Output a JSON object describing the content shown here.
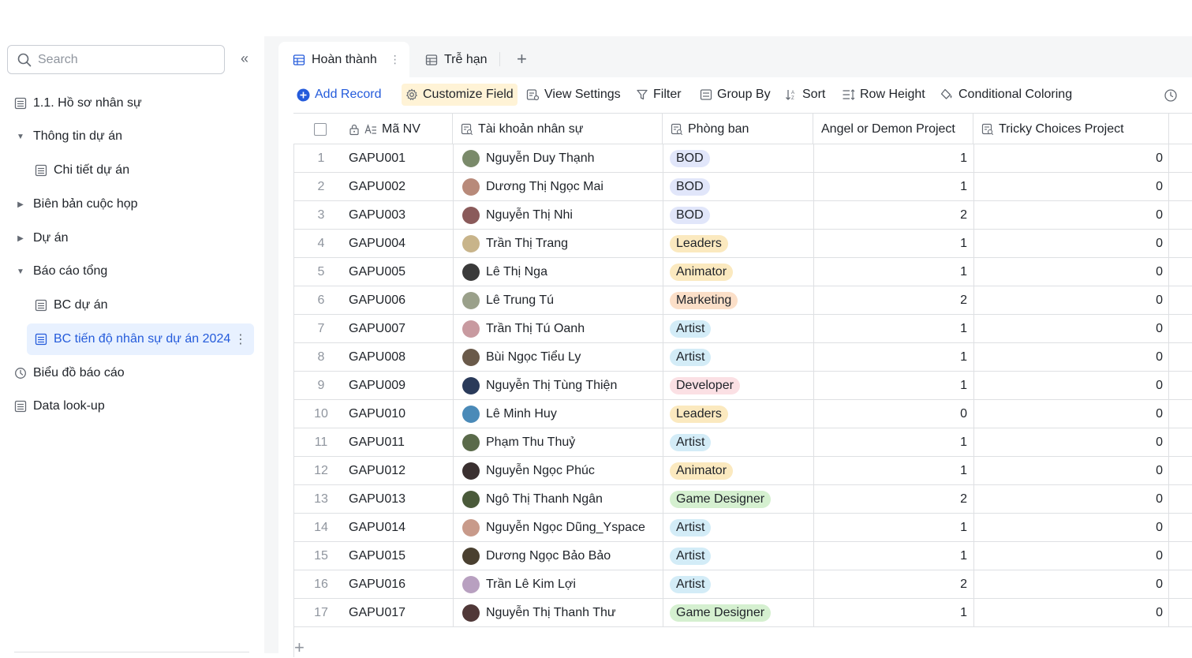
{
  "sidebar": {
    "search_placeholder": "Search",
    "collapse_label": "«",
    "items": [
      {
        "label": "1.1. Hồ sơ nhân sự"
      },
      {
        "label": "Thông tin dự án"
      },
      {
        "label": "Chi tiết dự án"
      },
      {
        "label": "Biên bản cuộc họp"
      },
      {
        "label": "Dự án"
      },
      {
        "label": "Báo cáo tổng"
      },
      {
        "label": "BC dự án"
      },
      {
        "label": "BC tiến độ nhân sự dự án 2024"
      },
      {
        "label": "Biểu đồ báo cáo"
      },
      {
        "label": "Data look-up"
      }
    ]
  },
  "tabs": [
    {
      "label": "Hoàn thành"
    },
    {
      "label": "Trễ hạn"
    }
  ],
  "toolbar": {
    "add_record": "Add Record",
    "customize_field": "Customize Field",
    "view_settings": "View Settings",
    "filter": "Filter",
    "group_by": "Group By",
    "sort": "Sort",
    "row_height": "Row Height",
    "conditional_coloring": "Conditional Coloring"
  },
  "columns": {
    "id": "Mã NV",
    "name": "Tài khoản nhân sự",
    "dept": "Phòng ban",
    "angel": "Angel or Demon Project",
    "tricky": "Tricky Choices Project"
  },
  "colors": {
    "accent": "#245bdb",
    "tag_BOD": "#e1e6fa",
    "tag_Leaders": "#fbe9bf",
    "tag_Animator": "#fbe9bf",
    "tag_Marketing": "#fbdfc8",
    "tag_Artist": "#d3ecf7",
    "tag_Developer": "#fbe0e4",
    "tag_GameDesigner": "#d5f0d0"
  },
  "rows": [
    {
      "num": "1",
      "id": "GAPU001",
      "name": "Nguyễn Duy Thạnh",
      "dept": "BOD",
      "angel": "1",
      "tricky": "0"
    },
    {
      "num": "2",
      "id": "GAPU002",
      "name": "Dương Thị Ngọc Mai",
      "dept": "BOD",
      "angel": "1",
      "tricky": "0"
    },
    {
      "num": "3",
      "id": "GAPU003",
      "name": "Nguyễn Thị  Nhi",
      "dept": "BOD",
      "angel": "2",
      "tricky": "0"
    },
    {
      "num": "4",
      "id": "GAPU004",
      "name": "Trần Thị Trang",
      "dept": "Leaders",
      "angel": "1",
      "tricky": "0"
    },
    {
      "num": "5",
      "id": "GAPU005",
      "name": "Lê Thị Nga",
      "dept": "Animator",
      "angel": "1",
      "tricky": "0"
    },
    {
      "num": "6",
      "id": "GAPU006",
      "name": "Lê Trung Tú",
      "dept": "Marketing",
      "angel": "2",
      "tricky": "0"
    },
    {
      "num": "7",
      "id": "GAPU007",
      "name": "Trần Thị Tú Oanh",
      "dept": "Artist",
      "angel": "1",
      "tricky": "0"
    },
    {
      "num": "8",
      "id": "GAPU008",
      "name": "Bùi Ngọc Tiểu Ly",
      "dept": "Artist",
      "angel": "1",
      "tricky": "0"
    },
    {
      "num": "9",
      "id": "GAPU009",
      "name": "Nguyễn Thị Tùng Thiện",
      "dept": "Developer",
      "angel": "1",
      "tricky": "0"
    },
    {
      "num": "10",
      "id": "GAPU010",
      "name": "Lê Minh Huy",
      "dept": "Leaders",
      "angel": "0",
      "tricky": "0"
    },
    {
      "num": "11",
      "id": "GAPU011",
      "name": "Phạm Thu Thuỷ",
      "dept": "Artist",
      "angel": "1",
      "tricky": "0"
    },
    {
      "num": "12",
      "id": "GAPU012",
      "name": "Nguyễn Ngọc Phúc",
      "dept": "Animator",
      "angel": "1",
      "tricky": "0"
    },
    {
      "num": "13",
      "id": "GAPU013",
      "name": "Ngô Thị Thanh Ngân",
      "dept": "Game Designer",
      "angel": "2",
      "tricky": "0"
    },
    {
      "num": "14",
      "id": "GAPU014",
      "name": "Nguyễn Ngọc Dũng_Yspace",
      "dept": "Artist",
      "angel": "1",
      "tricky": "0"
    },
    {
      "num": "15",
      "id": "GAPU015",
      "name": "Dương Ngọc Bảo Bảo",
      "dept": "Artist",
      "angel": "1",
      "tricky": "0"
    },
    {
      "num": "16",
      "id": "GAPU016",
      "name": "Trần Lê Kim Lợi",
      "dept": "Artist",
      "angel": "2",
      "tricky": "0"
    },
    {
      "num": "17",
      "id": "GAPU017",
      "name": "Nguyễn Thị Thanh Thư",
      "dept": "Game Designer",
      "angel": "1",
      "tricky": "0"
    }
  ]
}
